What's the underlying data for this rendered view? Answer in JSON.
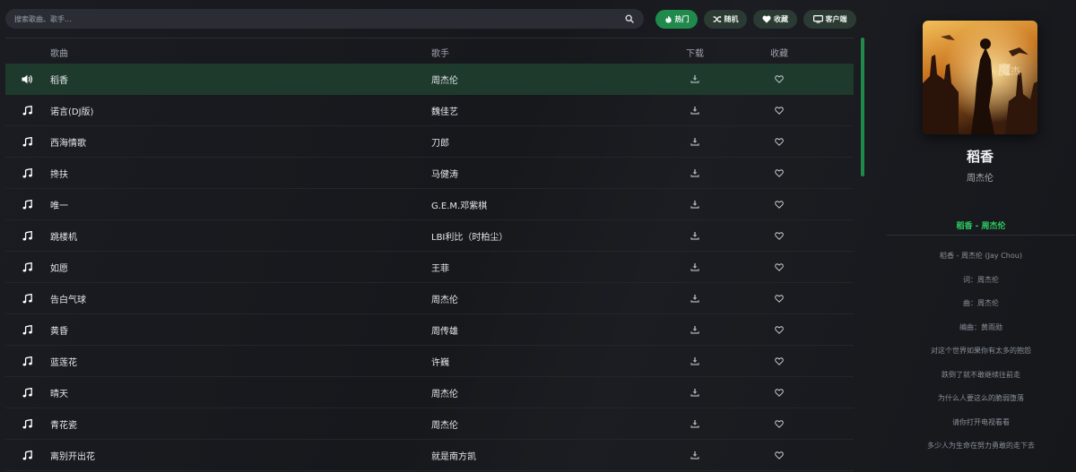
{
  "search": {
    "placeholder": "搜索歌曲、歌手..."
  },
  "toolbar": {
    "hot_label": "热门",
    "random_label": "随机",
    "favorites_label": "收藏",
    "client_label": "客户端"
  },
  "table": {
    "headers": {
      "name": "歌曲",
      "artist": "歌手",
      "download": "下载",
      "favorite": "收藏"
    },
    "rows": [
      {
        "name": "稻香",
        "artist": "周杰伦",
        "playing": true
      },
      {
        "name": "诺言(DJ版)",
        "artist": "魏佳艺"
      },
      {
        "name": "西海情歌",
        "artist": "刀郎"
      },
      {
        "name": "搀扶",
        "artist": "马健涛"
      },
      {
        "name": "唯一",
        "artist": "G.E.M.邓紫棋"
      },
      {
        "name": "跳楼机",
        "artist": "LBI利比（时柏尘）"
      },
      {
        "name": "如愿",
        "artist": "王菲"
      },
      {
        "name": "告白气球",
        "artist": "周杰伦"
      },
      {
        "name": "黄昏",
        "artist": "周传雄"
      },
      {
        "name": "蓝莲花",
        "artist": "许巍"
      },
      {
        "name": "晴天",
        "artist": "周杰伦"
      },
      {
        "name": "青花瓷",
        "artist": "周杰伦"
      },
      {
        "name": "离别开出花",
        "artist": "就是南方凯"
      }
    ]
  },
  "now_playing": {
    "title": "稻香",
    "artist": "周杰伦",
    "lyric_header": "稻香 - 周杰伦",
    "lyrics": [
      "稻香 - 周杰伦 (Jay Chou)",
      "词：周杰伦",
      "曲：周杰伦",
      "编曲：黄雨勋",
      "对这个世界如果你有太多的抱怨",
      "跌倒了就不敢继续往前走",
      "为什么人要这么的脆弱堕落",
      "请你打开电视看看",
      "多少人为生命在努力勇敢的走下去"
    ]
  },
  "colors": {
    "accent": "#1f8a4c",
    "lyric_highlight": "#2ecc5f",
    "playing_row": "#1d3a2c",
    "background": "#16181d"
  }
}
